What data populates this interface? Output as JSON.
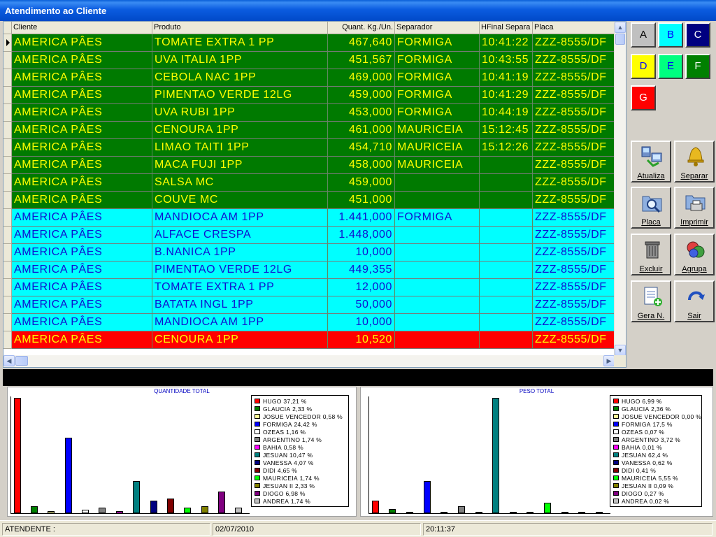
{
  "window": {
    "title": "Atendimento ao Cliente"
  },
  "grid": {
    "columns": [
      "Cliente",
      "Produto",
      "Quant. Kg./Un.",
      "Separador",
      "HFinal Separa",
      "Placa"
    ],
    "rows": [
      {
        "cliente": "AMERICA PÂES",
        "produto": "TOMATE EXTRA 1 PP",
        "quant": "467,640",
        "separador": "FORMIGA",
        "hfinal": "10:41:22",
        "placa": "ZZZ-8555/DF",
        "color": "green"
      },
      {
        "cliente": "AMERICA PÂES",
        "produto": "UVA ITALIA 1PP",
        "quant": "451,567",
        "separador": "FORMIGA",
        "hfinal": "10:43:55",
        "placa": "ZZZ-8555/DF",
        "color": "green"
      },
      {
        "cliente": "AMERICA PÂES",
        "produto": "CEBOLA NAC 1PP",
        "quant": "469,000",
        "separador": "FORMIGA",
        "hfinal": "10:41:19",
        "placa": "ZZZ-8555/DF",
        "color": "green"
      },
      {
        "cliente": "AMERICA PÂES",
        "produto": "PIMENTAO VERDE 12LG",
        "quant": "459,000",
        "separador": "FORMIGA",
        "hfinal": "10:41:29",
        "placa": "ZZZ-8555/DF",
        "color": "green"
      },
      {
        "cliente": "AMERICA PÂES",
        "produto": "UVA RUBI 1PP",
        "quant": "453,000",
        "separador": "FORMIGA",
        "hfinal": "10:44:19",
        "placa": "ZZZ-8555/DF",
        "color": "green"
      },
      {
        "cliente": "AMERICA PÂES",
        "produto": "CENOURA 1PP",
        "quant": "461,000",
        "separador": "MAURICEIA",
        "hfinal": "15:12:45",
        "placa": "ZZZ-8555/DF",
        "color": "green"
      },
      {
        "cliente": "AMERICA PÂES",
        "produto": "LIMAO TAITI 1PP",
        "quant": "454,710",
        "separador": "MAURICEIA",
        "hfinal": "15:12:26",
        "placa": "ZZZ-8555/DF",
        "color": "green"
      },
      {
        "cliente": "AMERICA PÂES",
        "produto": "MACA FUJI 1PP",
        "quant": "458,000",
        "separador": "MAURICEIA",
        "hfinal": "",
        "placa": "ZZZ-8555/DF",
        "color": "green"
      },
      {
        "cliente": "AMERICA PÂES",
        "produto": "SALSA MC",
        "quant": "459,000",
        "separador": "",
        "hfinal": "",
        "placa": "ZZZ-8555/DF",
        "color": "green"
      },
      {
        "cliente": "AMERICA PÂES",
        "produto": "COUVE MC",
        "quant": "451,000",
        "separador": "",
        "hfinal": "",
        "placa": "ZZZ-8555/DF",
        "color": "green"
      },
      {
        "cliente": "AMERICA PÂES",
        "produto": "MANDIOCA AM 1PP",
        "quant": "1.441,000",
        "separador": "FORMIGA",
        "hfinal": "",
        "placa": "ZZZ-8555/DF",
        "color": "cyan"
      },
      {
        "cliente": "AMERICA PÂES",
        "produto": "ALFACE CRESPA",
        "quant": "1.448,000",
        "separador": "",
        "hfinal": "",
        "placa": "ZZZ-8555/DF",
        "color": "cyan"
      },
      {
        "cliente": "AMERICA PÂES",
        "produto": "B.NANICA 1PP",
        "quant": "10,000",
        "separador": "",
        "hfinal": "",
        "placa": "ZZZ-8555/DF",
        "color": "cyan"
      },
      {
        "cliente": "AMERICA PÂES",
        "produto": "PIMENTAO VERDE 12LG",
        "quant": "449,355",
        "separador": "",
        "hfinal": "",
        "placa": "ZZZ-8555/DF",
        "color": "cyan"
      },
      {
        "cliente": "AMERICA PÂES",
        "produto": "TOMATE EXTRA 1 PP",
        "quant": "12,000",
        "separador": "",
        "hfinal": "",
        "placa": "ZZZ-8555/DF",
        "color": "cyan"
      },
      {
        "cliente": "AMERICA PÂES",
        "produto": "BATATA INGL 1PP",
        "quant": "50,000",
        "separador": "",
        "hfinal": "",
        "placa": "ZZZ-8555/DF",
        "color": "cyan"
      },
      {
        "cliente": "AMERICA PÂES",
        "produto": "MANDIOCA AM 1PP",
        "quant": "10,000",
        "separador": "",
        "hfinal": "",
        "placa": "ZZZ-8555/DF",
        "color": "cyan"
      },
      {
        "cliente": "AMERICA PÂES",
        "produto": "CENOURA 1PP",
        "quant": "10,520",
        "separador": "",
        "hfinal": "",
        "placa": "ZZZ-8555/DF",
        "color": "red"
      }
    ]
  },
  "letter_buttons": [
    {
      "label": "A",
      "bg": "#c0c0c0",
      "fg": "#000000"
    },
    {
      "label": "B",
      "bg": "#00ffff",
      "fg": "#0000ff"
    },
    {
      "label": "C",
      "bg": "#000080",
      "fg": "#ffffff"
    },
    {
      "label": "D",
      "bg": "#ffff00",
      "fg": "#0000ff"
    },
    {
      "label": "E",
      "bg": "#00ff80",
      "fg": "#0000ff"
    },
    {
      "label": "F",
      "bg": "#008000",
      "fg": "#ffffff"
    },
    {
      "label": "G",
      "bg": "#ff0000",
      "fg": "#ffffff"
    }
  ],
  "toolbar": {
    "atualiza": "Atualiza",
    "separar": "Separar",
    "placa": "Placa",
    "imprimir": "Imprimir",
    "excluir": "Excluir",
    "agrupa": "Agrupa",
    "gera": "Gera N.",
    "sair": "Sair"
  },
  "charts": [
    {
      "type": "bar",
      "title": "QUANTIDADE TOTAL",
      "legend": [
        {
          "name": "HUGO",
          "pct": "37,21 %",
          "color": "#ff0000",
          "value": 37.21
        },
        {
          "name": "GLAUCIA",
          "pct": "2,33 %",
          "color": "#008000",
          "value": 2.33
        },
        {
          "name": "JOSUE VENCEDOR",
          "pct": "0,58 %",
          "color": "#ffff99",
          "value": 0.58
        },
        {
          "name": "FORMIGA",
          "pct": "24,42 %",
          "color": "#0000ff",
          "value": 24.42
        },
        {
          "name": "OZEAS",
          "pct": "1,16 %",
          "color": "#ffffff",
          "value": 1.16
        },
        {
          "name": "ARGENTINO",
          "pct": "1,74 %",
          "color": "#808080",
          "value": 1.74
        },
        {
          "name": "BAHIA",
          "pct": "0,58 %",
          "color": "#ff00ff",
          "value": 0.58
        },
        {
          "name": "JESUAN",
          "pct": "10,47 %",
          "color": "#008080",
          "value": 10.47
        },
        {
          "name": "VANESSA",
          "pct": "4,07 %",
          "color": "#000080",
          "value": 4.07
        },
        {
          "name": "DIDI",
          "pct": "4,65 %",
          "color": "#800000",
          "value": 4.65
        },
        {
          "name": "MAURICEIA",
          "pct": "1,74 %",
          "color": "#00ff00",
          "value": 1.74
        },
        {
          "name": "JESUAN II",
          "pct": "2,33 %",
          "color": "#808000",
          "value": 2.33
        },
        {
          "name": "DIOGO",
          "pct": "6,98 %",
          "color": "#800080",
          "value": 6.98
        },
        {
          "name": "ANDREA",
          "pct": "1,74 %",
          "color": "#c0c0c0",
          "value": 1.74
        }
      ]
    },
    {
      "type": "bar",
      "title": "PESO TOTAL",
      "legend": [
        {
          "name": "HUGO",
          "pct": "6,99 %",
          "color": "#ff0000",
          "value": 6.99
        },
        {
          "name": "GLAUCIA",
          "pct": "2,36 %",
          "color": "#008000",
          "value": 2.36
        },
        {
          "name": "JOSUE VENCEDOR",
          "pct": "0,00 %",
          "color": "#ffff99",
          "value": 0.0
        },
        {
          "name": "FORMIGA",
          "pct": "17,5 %",
          "color": "#0000ff",
          "value": 17.5
        },
        {
          "name": "OZEAS",
          "pct": "0,07 %",
          "color": "#ffffff",
          "value": 0.07
        },
        {
          "name": "ARGENTINO",
          "pct": "3,72 %",
          "color": "#808080",
          "value": 3.72
        },
        {
          "name": "BAHIA",
          "pct": "0,01 %",
          "color": "#ff00ff",
          "value": 0.01
        },
        {
          "name": "JESUAN",
          "pct": "62,4 %",
          "color": "#008080",
          "value": 62.4
        },
        {
          "name": "VANESSA",
          "pct": "0,62 %",
          "color": "#000080",
          "value": 0.62
        },
        {
          "name": "DIDI",
          "pct": "0,41 %",
          "color": "#800000",
          "value": 0.41
        },
        {
          "name": "MAURICEIA",
          "pct": "5,55 %",
          "color": "#00ff00",
          "value": 5.55
        },
        {
          "name": "JESUAN II",
          "pct": "0,09 %",
          "color": "#808000",
          "value": 0.09
        },
        {
          "name": "DIOGO",
          "pct": "0,27 %",
          "color": "#800080",
          "value": 0.27
        },
        {
          "name": "ANDREA",
          "pct": "0,02 %",
          "color": "#c0c0c0",
          "value": 0.02
        }
      ]
    }
  ],
  "status": {
    "atendente": "ATENDENTE :",
    "date": "02/07/2010",
    "time": "20:11:37"
  }
}
